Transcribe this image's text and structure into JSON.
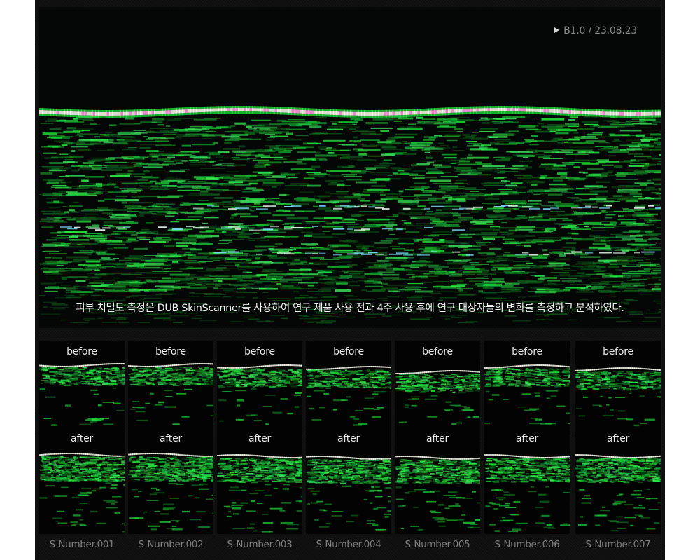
{
  "header": {
    "version_label": "B1.0 / 23.08.23"
  },
  "hero": {
    "caption": "피부 치밀도 측정은 DUB SkinScanner를 사용하여 연구 제품 사용 전과 4주 사용 후에 연구 대상자들의  변화를 측정하고 분석하였다."
  },
  "samples": [
    {
      "before": "before",
      "after": "after",
      "id": "S-Number.001"
    },
    {
      "before": "before",
      "after": "after",
      "id": "S-Number.002"
    },
    {
      "before": "before",
      "after": "after",
      "id": "S-Number.003"
    },
    {
      "before": "before",
      "after": "after",
      "id": "S-Number.004"
    },
    {
      "before": "before",
      "after": "after",
      "id": "S-Number.005"
    },
    {
      "before": "before",
      "after": "after",
      "id": "S-Number.006"
    },
    {
      "before": "before",
      "after": "after",
      "id": "S-Number.007"
    }
  ],
  "colors": {
    "scan_green": "#1fd83a",
    "scan_bright": "#f2f2e6",
    "background": "#111111"
  }
}
